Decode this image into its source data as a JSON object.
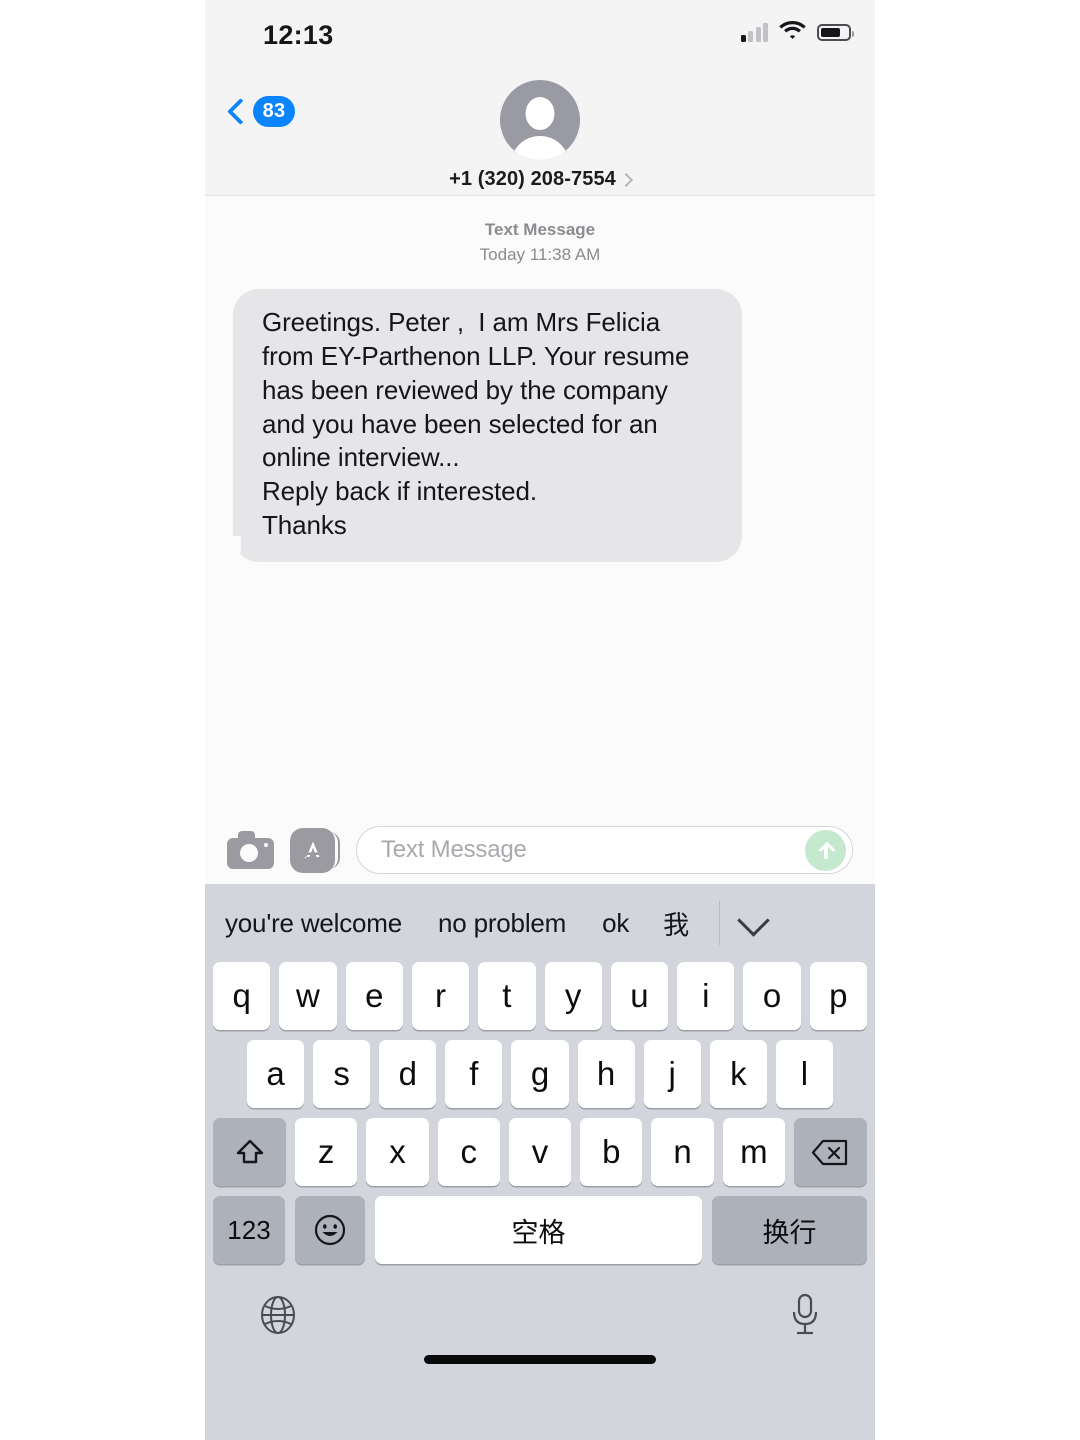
{
  "status_bar": {
    "time": "12:13",
    "cellular_icon": "cellular-signal-icon",
    "wifi_icon": "wifi-icon",
    "battery_icon": "battery-icon"
  },
  "nav": {
    "back_icon": "chevron-left-icon",
    "unread_badge": "83",
    "avatar_icon": "contact-avatar-placeholder",
    "contact_name": "+1 (320) 208-7554",
    "detail_chevron_icon": "chevron-right-icon"
  },
  "conversation": {
    "timestamp_label": "Text Message",
    "timestamp_value": "Today 11:38 AM",
    "messages": [
      {
        "sender": "incoming",
        "text": "Greetings. Peter ,  I am Mrs Felicia from EY-Parthenon LLP. Your resume has been reviewed by the company and you have been selected for an online interview...\nReply back if interested.\nThanks"
      }
    ]
  },
  "input_bar": {
    "camera_icon": "camera-icon",
    "appstore_icon": "app-store-icon",
    "placeholder": "Text Message",
    "send_icon": "send-arrow-up-icon"
  },
  "keyboard": {
    "suggestions": [
      "you're welcome",
      "no problem",
      "ok",
      "我"
    ],
    "collapse_icon": "chevron-down-icon",
    "row1": [
      "q",
      "w",
      "e",
      "r",
      "t",
      "y",
      "u",
      "i",
      "o",
      "p"
    ],
    "row2": [
      "a",
      "s",
      "d",
      "f",
      "g",
      "h",
      "j",
      "k",
      "l"
    ],
    "row3": [
      "z",
      "x",
      "c",
      "v",
      "b",
      "n",
      "m"
    ],
    "shift_icon": "shift-arrow-icon",
    "delete_icon": "backspace-delete-icon",
    "numeric_key": "123",
    "emoji_icon": "emoji-smiley-icon",
    "space_key": "空格",
    "return_key": "换行",
    "globe_icon": "globe-language-icon",
    "mic_icon": "microphone-icon"
  },
  "colors": {
    "accent_blue": "#0a84ff",
    "bubble_incoming": "#e6e6e8",
    "keyboard_bg": "#d2d5db",
    "key_gray": "#adb1ba",
    "send_green": "#c5e9cf"
  }
}
